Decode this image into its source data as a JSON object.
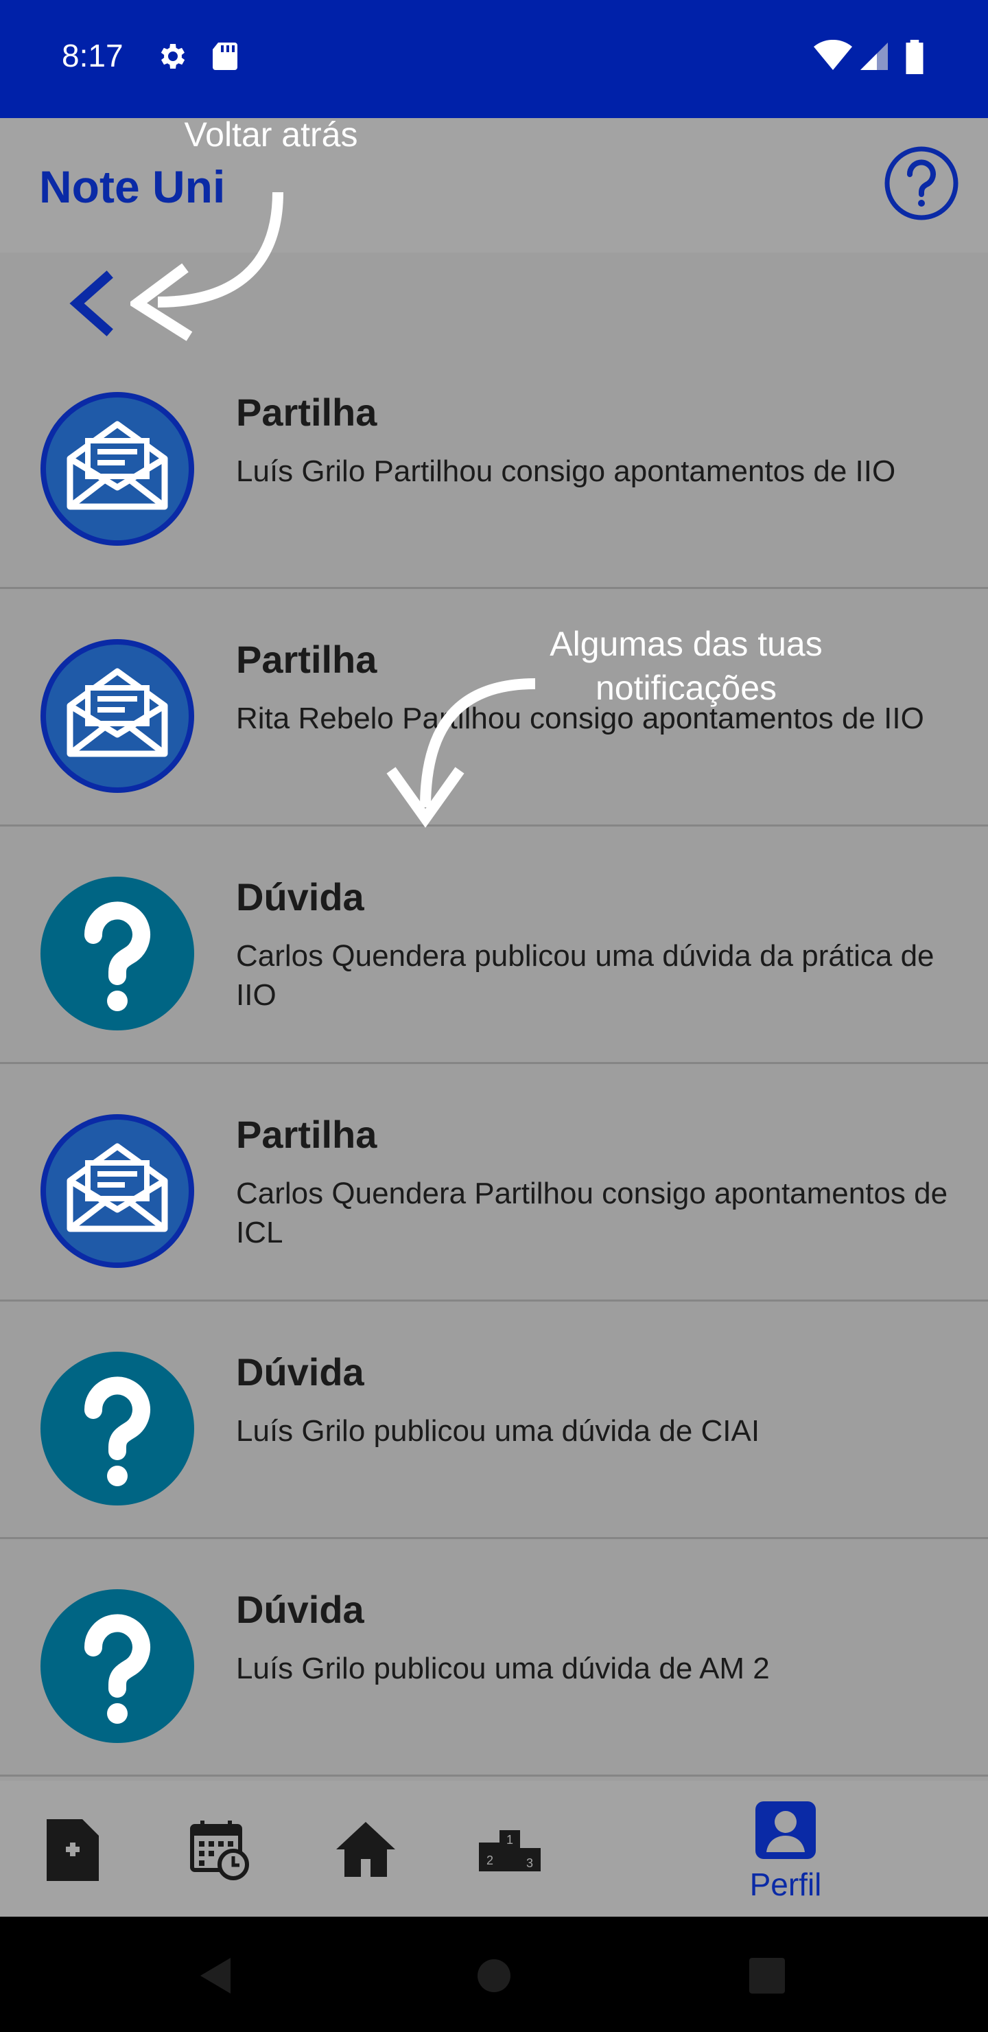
{
  "status_bar": {
    "time": "8:17",
    "icons": [
      "gear-icon",
      "sd-card-icon",
      "wifi-icon",
      "signal-icon",
      "battery-icon"
    ]
  },
  "app": {
    "title": "Note Uni",
    "accent": "#0a2aa6"
  },
  "annotations": {
    "back_hint": "Voltar atrás",
    "list_hint": "Algumas das tuas notificações"
  },
  "notifications": [
    {
      "type": "share",
      "icon": "envelope-icon",
      "title": "Partilha",
      "text": "Luís Grilo Partilhou consigo apontamentos de IIO"
    },
    {
      "type": "share",
      "icon": "envelope-icon",
      "title": "Partilha",
      "text": "Rita Rebelo Partilhou consigo apontamentos de IIO"
    },
    {
      "type": "question",
      "icon": "question-icon",
      "title": "Dúvida",
      "text": "Carlos Quendera publicou uma dúvida da prática de IIO"
    },
    {
      "type": "share",
      "icon": "envelope-icon",
      "title": "Partilha",
      "text": "Carlos Quendera Partilhou consigo apontamentos de ICL"
    },
    {
      "type": "question",
      "icon": "question-icon",
      "title": "Dúvida",
      "text": "Luís Grilo publicou uma dúvida de CIAI"
    },
    {
      "type": "question",
      "icon": "question-icon",
      "title": "Dúvida",
      "text": "Luís Grilo publicou uma dúvida de AM 2"
    }
  ],
  "bottom_nav": {
    "items": [
      {
        "icon": "add-document-icon",
        "label": ""
      },
      {
        "icon": "calendar-clock-icon",
        "label": ""
      },
      {
        "icon": "home-icon",
        "label": ""
      },
      {
        "icon": "podium-icon",
        "label": ""
      },
      {
        "icon": "profile-icon",
        "label": "Perfil",
        "active": true
      }
    ]
  }
}
